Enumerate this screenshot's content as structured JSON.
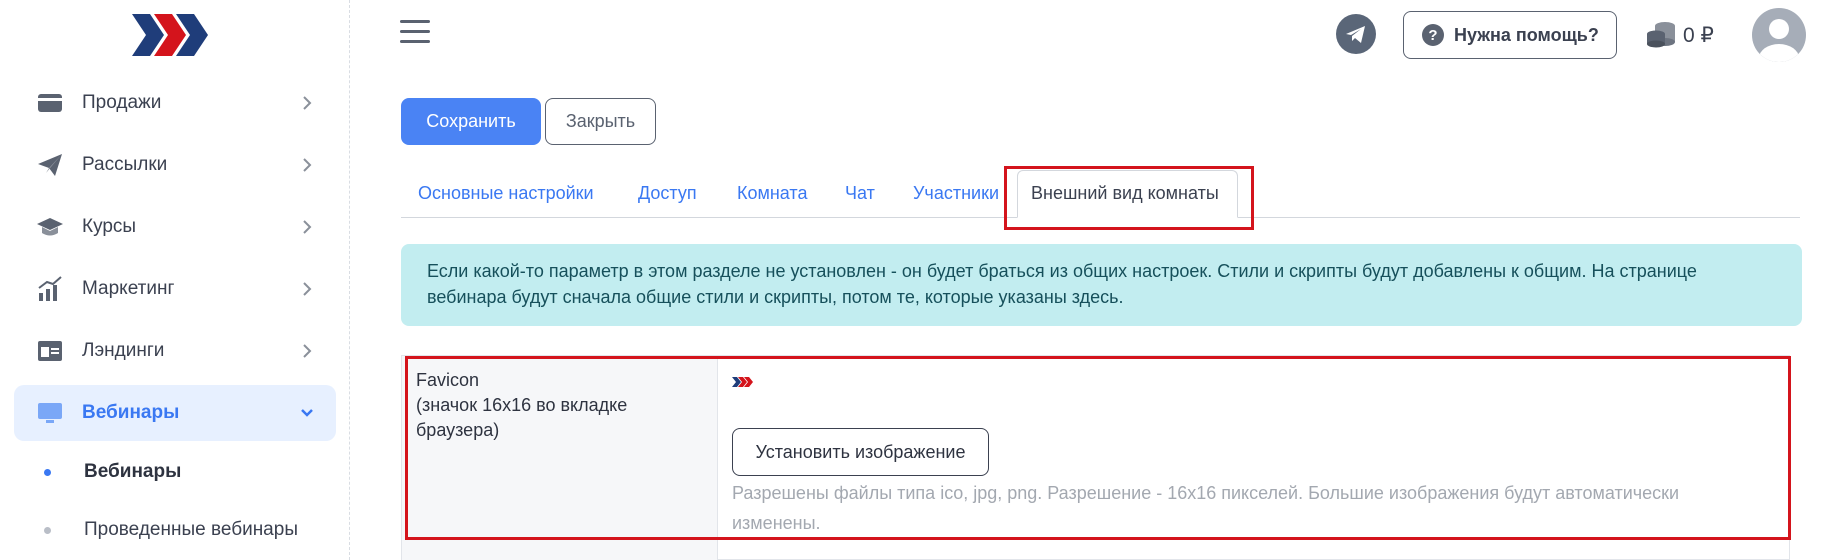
{
  "colors": {
    "accent": "#4a83f4",
    "active_bg": "#e7f0ff",
    "alert_bg": "#c2edf0",
    "highlight": "#d4141c"
  },
  "sidebar": {
    "logo": "logo-chevrons",
    "items": [
      {
        "label": "Продажи",
        "icon": "wallet-icon",
        "active": false
      },
      {
        "label": "Рассылки",
        "icon": "paper-plane-icon",
        "active": false
      },
      {
        "label": "Курсы",
        "icon": "graduation-cap-icon",
        "active": false
      },
      {
        "label": "Маркетинг",
        "icon": "chart-icon",
        "active": false
      },
      {
        "label": "Лэндинги",
        "icon": "landing-page-icon",
        "active": false
      },
      {
        "label": "Вебинары",
        "icon": "monitor-icon",
        "active": true
      }
    ],
    "sub_items": [
      {
        "label": "Вебинары",
        "active": true
      },
      {
        "label": "Проведенные вебинары",
        "active": false
      }
    ]
  },
  "header": {
    "help_label": "Нужна помощь?",
    "balance": "0 ₽"
  },
  "actions": {
    "save_label": "Сохранить",
    "close_label": "Закрыть"
  },
  "tabs": [
    {
      "label": "Основные настройки",
      "active": false
    },
    {
      "label": "Доступ",
      "active": false
    },
    {
      "label": "Комната",
      "active": false
    },
    {
      "label": "Чат",
      "active": false
    },
    {
      "label": "Участники",
      "active": false
    },
    {
      "label": "Внешний вид комнаты",
      "active": true
    }
  ],
  "alert": {
    "text": "Если какой-то параметр в этом разделе не установлен - он будет браться из общих настроек. Стили и скрипты будут добавлены к общим. На странице вебинара будут сначала общие стили и скрипты, потом те, которые указаны здесь."
  },
  "favicon_row": {
    "label_line1": "Favicon",
    "label_line2": "(значок 16x16 во вкладке браузера)",
    "upload_label": "Установить изображение",
    "hint": "Разрешены файлы типа ico, jpg, png. Разрешение - 16x16 пикселей. Большие изображения будут автоматически изменены."
  }
}
